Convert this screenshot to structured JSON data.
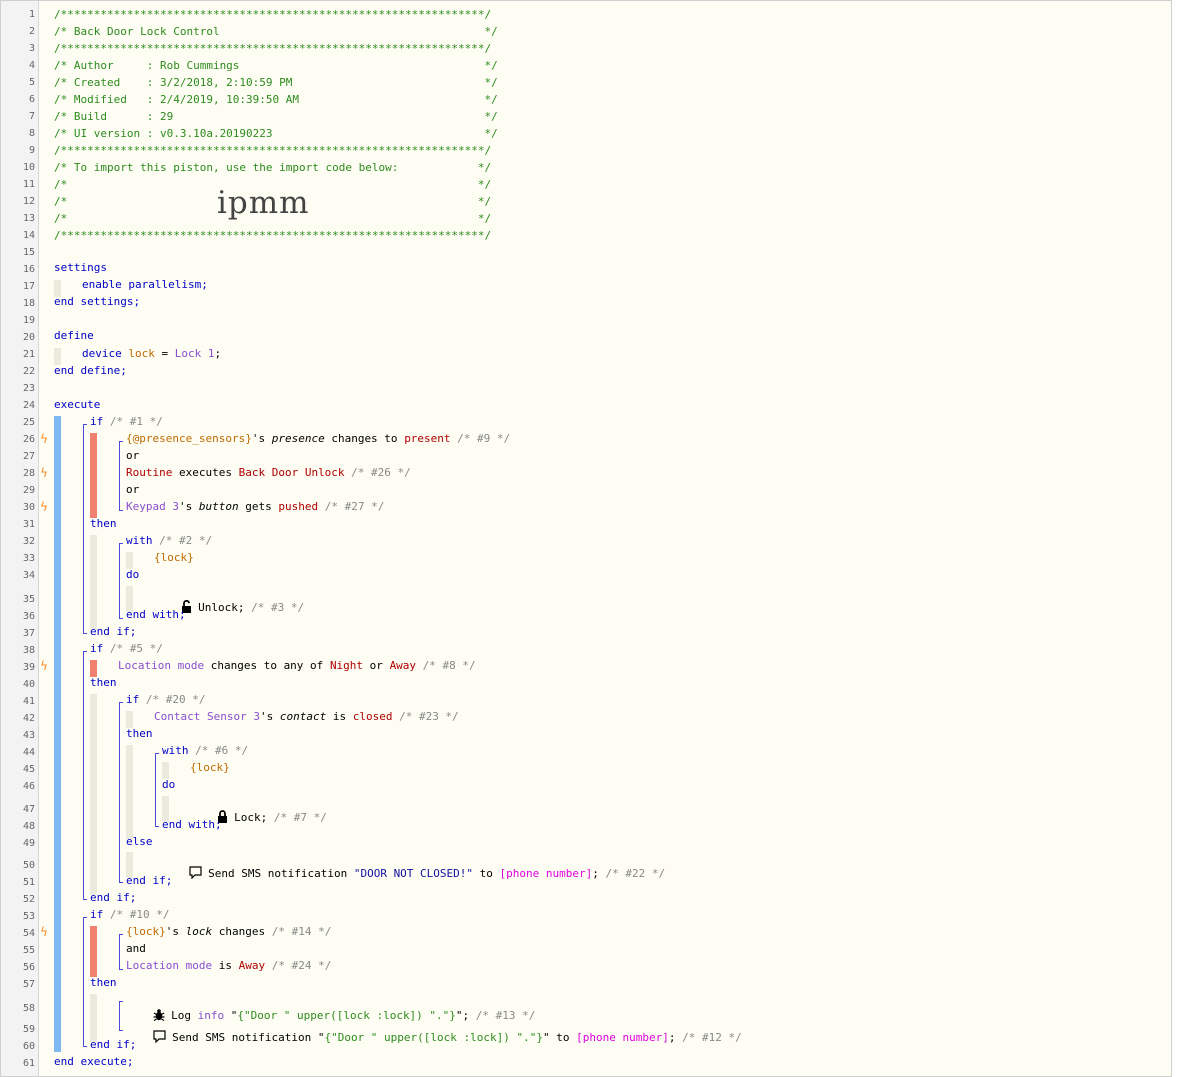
{
  "lines": [
    {
      "n": "1",
      "t": "/****************************************************************/"
    },
    {
      "n": "2",
      "t": "/* Back Door Lock Control                                        */"
    },
    {
      "n": "3",
      "t": "/****************************************************************/"
    },
    {
      "n": "4",
      "t": "/* Author     : Rob Cummings                                     */"
    },
    {
      "n": "5",
      "t": "/* Created    : 3/2/2018, 2:10:59 PM                             */"
    },
    {
      "n": "6",
      "t": "/* Modified   : 2/4/2019, 10:39:50 AM                            */"
    },
    {
      "n": "7",
      "t": "/* Build      : 29                                               */"
    },
    {
      "n": "8",
      "t": "/* UI version : v0.3.10a.20190223                                */"
    },
    {
      "n": "9",
      "t": "/****************************************************************/"
    },
    {
      "n": "10",
      "t": "/* To import this piston, use the import code below:            */"
    },
    {
      "n": "11",
      "t": "/*                                                              */"
    },
    {
      "n": "12",
      "t": "/*                                                              */"
    },
    {
      "n": "13",
      "t": "/*                                                              */"
    },
    {
      "n": "14",
      "t": "/****************************************************************/"
    }
  ],
  "import_code": "ipmm",
  "code": {
    "l16": "settings",
    "l17": "enable parallelism;",
    "l18": "end settings;",
    "l20": "define",
    "l21a": "device",
    "l21b": "lock",
    "l21c": " = ",
    "l21d": "Lock 1",
    "l21e": ";",
    "l22": "end define;",
    "l24": "execute",
    "l25a": "if",
    "l25b": " /* #1 */",
    "l26a": "{@presence_sensors}",
    "l26b": "'s ",
    "l26c": "presence",
    "l26d": " changes to ",
    "l26e": "present",
    "l26f": " /* #9 */",
    "l27": "or",
    "l28a": "Routine",
    "l28b": " executes ",
    "l28c": "Back Door Unlock",
    "l28d": " /* #26 */",
    "l29": "or",
    "l30a": "Keypad 3",
    "l30b": "'s ",
    "l30c": "button",
    "l30d": " gets ",
    "l30e": "pushed",
    "l30f": " /* #27 */",
    "l31": "then",
    "l32a": "with",
    "l32b": " /* #2 */",
    "l33": "{lock}",
    "l34": "do",
    "l35a": " Unlock;",
    "l35b": " /* #3 */",
    "l36": "end with;",
    "l37": "end if;",
    "l38a": "if",
    "l38b": " /* #5 */",
    "l39a": "Location mode",
    "l39b": " changes to any of ",
    "l39c": "Night",
    "l39d": " or ",
    "l39e": "Away",
    "l39f": " /* #8 */",
    "l40": "then",
    "l41a": "if",
    "l41b": " /* #20 */",
    "l42a": "Contact Sensor 3",
    "l42b": "'s ",
    "l42c": "contact",
    "l42d": " is ",
    "l42e": "closed",
    "l42f": " /* #23 */",
    "l43": "then",
    "l44a": "with",
    "l44b": " /* #6 */",
    "l45": "{lock}",
    "l46": "do",
    "l47a": " Lock;",
    "l47b": " /* #7 */",
    "l48": "end with;",
    "l49": "else",
    "l50a": " Send SMS notification ",
    "l50b": "\"DOOR NOT CLOSED!\"",
    "l50c": " to ",
    "l50d": "[phone number]",
    "l50e": ";",
    "l50f": " /* #22 */",
    "l51": "end if;",
    "l52": "end if;",
    "l53a": "if",
    "l53b": " /* #10 */",
    "l54a": "{lock}",
    "l54b": "'s ",
    "l54c": "lock",
    "l54d": " changes",
    "l54e": " /* #14 */",
    "l55": "and",
    "l56a": "Location mode",
    "l56b": " is ",
    "l56c": "Away",
    "l56d": " /* #24 */",
    "l57": "then",
    "l58a": " Log ",
    "l58b": "info",
    "l58c": " \"",
    "l58d": "{\"Door \" upper([lock :lock]) \".\"}",
    "l58e": "\";",
    "l58f": " /* #13 */",
    "l59a": " Send SMS notification \"",
    "l59b": "{\"Door \" upper([lock :lock]) \".\"}",
    "l59c": "\" to ",
    "l59d": "[phone number]",
    "l59e": ";",
    "l59f": " /* #12 */",
    "l60": "end if;",
    "l61": "end execute;"
  },
  "line_numbers": [
    "15",
    "16",
    "17",
    "18",
    "19",
    "20",
    "21",
    "22",
    "23",
    "24",
    "25",
    "26",
    "27",
    "28",
    "29",
    "30",
    "31",
    "32",
    "33",
    "34",
    "35",
    "36",
    "37",
    "38",
    "39",
    "40",
    "41",
    "42",
    "43",
    "44",
    "45",
    "46",
    "47",
    "48",
    "49",
    "50",
    "51",
    "52",
    "53",
    "54",
    "55",
    "56",
    "57",
    "58",
    "59",
    "60",
    "61"
  ],
  "trigger_glyph": "ϟ",
  "icons": {
    "unlock": "unlocked-padlock-icon",
    "lock": "padlock-icon",
    "sms": "speech-bubble-icon",
    "log": "bug-icon",
    "trigger": "lightning-icon"
  },
  "colors": {
    "comment": "#2e8b1e",
    "keyword": "#0000c8",
    "device": "#8a4fd0",
    "variable": "#c06a00",
    "value": "#b00000",
    "trigger_bar": "#f0816e",
    "block_bar": "#7fb9f4",
    "trigger_icon": "#ff8c28"
  }
}
